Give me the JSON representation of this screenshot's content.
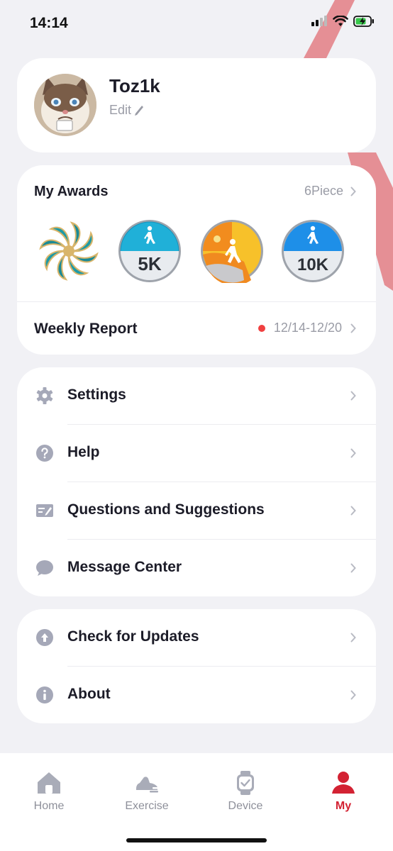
{
  "status_bar": {
    "time": "14:14"
  },
  "profile": {
    "username": "Toz1k",
    "edit_label": "Edit"
  },
  "awards": {
    "title": "My Awards",
    "count_label": "6Piece",
    "medals": [
      {
        "name": "pinwheel-medal",
        "label": ""
      },
      {
        "name": "5k-walk-medal",
        "label": "5K"
      },
      {
        "name": "sunrise-walk-medal",
        "label": ""
      },
      {
        "name": "10k-walk-medal",
        "label": "10K"
      }
    ],
    "weekly_report": {
      "title": "Weekly Report",
      "date_range": "12/14-12/20"
    }
  },
  "menu_primary": [
    {
      "icon": "gear-icon",
      "label": "Settings"
    },
    {
      "icon": "help-icon",
      "label": "Help"
    },
    {
      "icon": "feedback-icon",
      "label": "Questions and Suggestions"
    },
    {
      "icon": "message-icon",
      "label": "Message Center"
    }
  ],
  "menu_secondary": [
    {
      "icon": "update-icon",
      "label": "Check for Updates"
    },
    {
      "icon": "info-icon",
      "label": "About"
    }
  ],
  "tabbar": {
    "items": [
      {
        "icon": "home-icon",
        "label": "Home",
        "active": false
      },
      {
        "icon": "shoe-icon",
        "label": "Exercise",
        "active": false
      },
      {
        "icon": "watch-icon",
        "label": "Device",
        "active": false
      },
      {
        "icon": "person-icon",
        "label": "My",
        "active": true
      }
    ]
  },
  "colors": {
    "accent": "#d32233",
    "background": "#f1f1f5",
    "icon_gray": "#a5a8b8",
    "dot_red": "#f04040"
  }
}
